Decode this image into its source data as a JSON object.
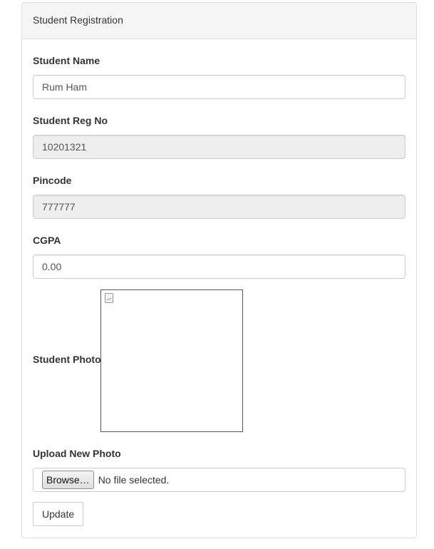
{
  "panel": {
    "title": "Student Registration"
  },
  "fields": {
    "name": {
      "label": "Student Name",
      "value": "Rum Ham"
    },
    "reg_no": {
      "label": "Student Reg No",
      "value": "10201321"
    },
    "pincode": {
      "label": "Pincode",
      "value": "777777"
    },
    "cgpa": {
      "label": "CGPA",
      "value": "0.00"
    }
  },
  "photo": {
    "label": "Student Photo",
    "icon": "broken-image-icon"
  },
  "upload": {
    "label": "Upload New Photo",
    "browse_label": "Browse…",
    "status": "No file selected."
  },
  "actions": {
    "update_label": "Update"
  },
  "colors": {
    "heading_bg": "#f5f5f5",
    "readonly_bg": "#eeeeee",
    "border": "#cccccc"
  }
}
